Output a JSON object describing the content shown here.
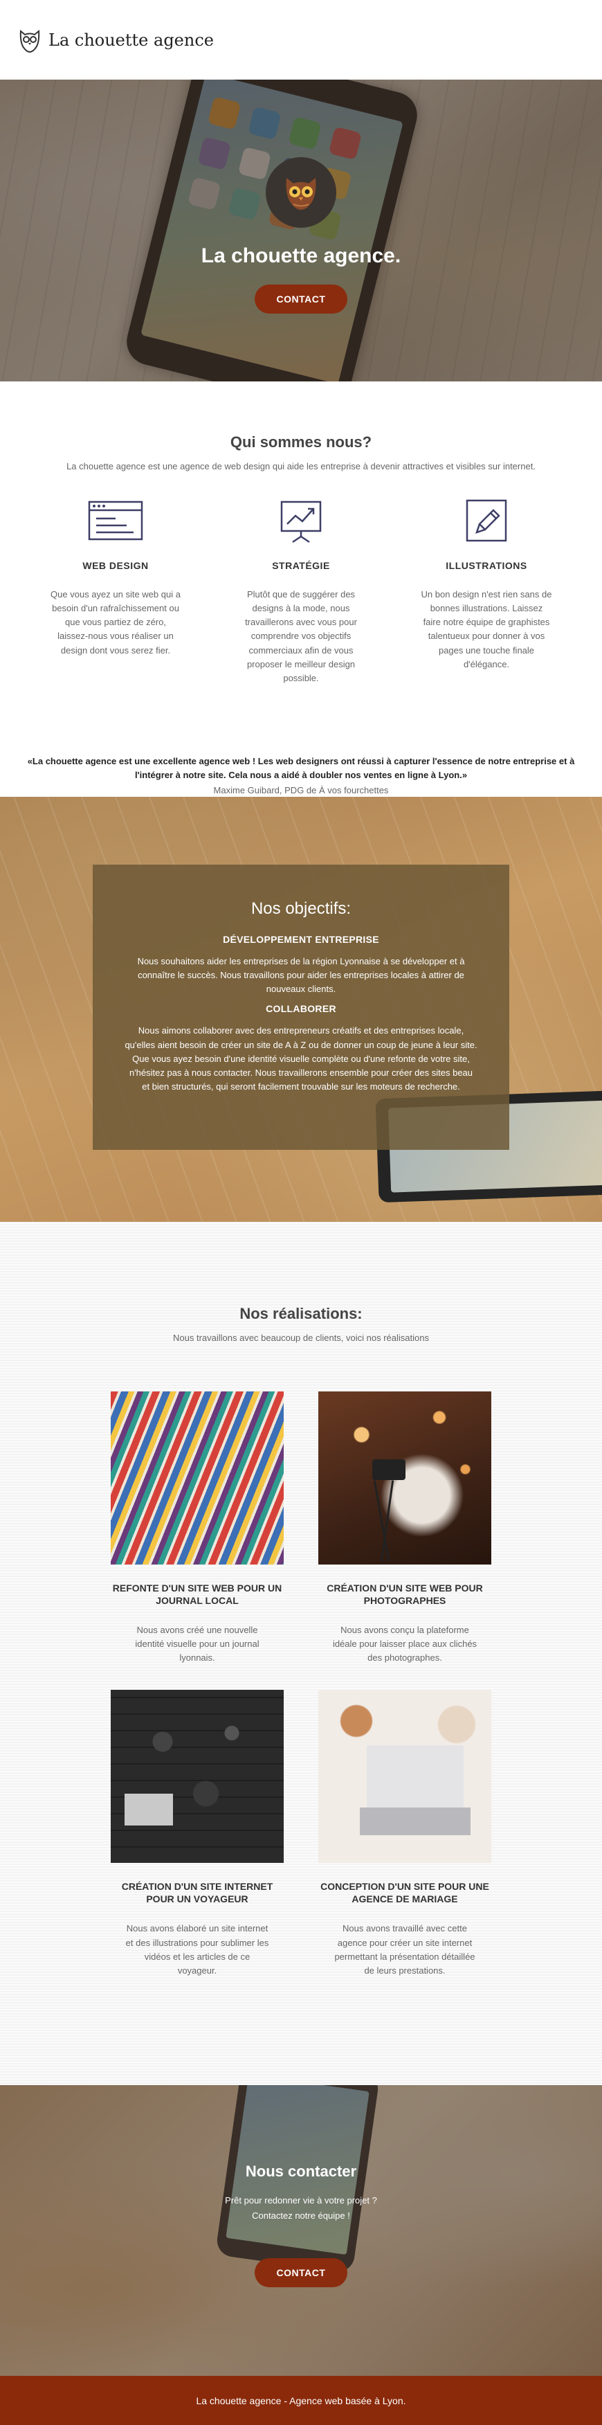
{
  "header": {
    "brand": "La chouette agence"
  },
  "hero": {
    "title": "La chouette agence.",
    "button": "CONTACT"
  },
  "about": {
    "title": "Qui sommes nous?",
    "lead": "La chouette agence est une agence de web design qui aide les entreprise à devenir attractives et visibles sur internet.",
    "services": [
      {
        "icon": "browser-window-icon",
        "title": "WEB DESIGN",
        "text": "Que vous ayez un site web qui a besoin d'un rafraîchissement ou que vous partiez de zéro, laissez-nous vous réaliser un design dont vous serez fier."
      },
      {
        "icon": "chart-board-icon",
        "title": "STRATÉGIE",
        "text": "Plutôt que de suggérer des designs à la mode, nous travaillerons avec vous pour comprendre vos objectifs commerciaux afin de vous proposer le meilleur design possible."
      },
      {
        "icon": "pencil-icon",
        "title": "ILLUSTRATIONS",
        "text": "Un bon design n'est rien sans de bonnes illustrations. Laissez faire notre équipe de graphistes talentueux pour donner à vos pages une touche finale d'élégance."
      }
    ]
  },
  "testimonial": {
    "quote": "«La chouette agence est une excellente agence web ! Les web designers ont réussi à capturer l'essence de notre entreprise et à l'intégrer à notre site. Cela nous a aidé à doubler nos ventes en ligne à Lyon.»",
    "author": "Maxime Guibard, PDG de À vos fourchettes"
  },
  "goals": {
    "title": "Nos objectifs:",
    "sections": [
      {
        "subtitle": "DÉVELOPPEMENT ENTREPRISE",
        "text": "Nous souhaitons aider les entreprises de la région Lyonnaise à se développer et à connaître le succès. Nous travaillons pour aider les entreprises locales à attirer de nouveaux clients."
      },
      {
        "subtitle": "COLLABORER",
        "text": "Nous aimons collaborer avec des entrepreneurs créatifs et des entreprises locale, qu'elles aient besoin de créer un site de A à Z ou de donner un coup de jeune à leur site. Que vous ayez besoin d'une identité visuelle complète ou d'une refonte de votre site, n'hésitez pas à nous contacter. Nous travaillerons ensemble pour créer des sites beau et bien structurés, qui seront facilement trouvable sur les moteurs de recherche."
      }
    ]
  },
  "works": {
    "title": "Nos réalisations:",
    "lead": "Nous travaillons avec beaucoup de clients, voici nos réalisations",
    "items": [
      {
        "title": "REFONTE D'UN SITE WEB POUR UN JOURNAL LOCAL",
        "text": "Nous avons créé une nouvelle identité visuelle pour un journal lyonnais."
      },
      {
        "title": "CRÉATION D'UN SITE WEB POUR PHOTOGRAPHES",
        "text": "Nous avons conçu la plateforme idéale pour laisser place aux clichés des photographes."
      },
      {
        "title": "CRÉATION D'UN SITE INTERNET POUR UN VOYAGEUR",
        "text": "Nous avons élaboré un site internet et des illustrations pour sublimer les vidéos et les articles de ce voyageur."
      },
      {
        "title": "CONCEPTION D'UN SITE POUR UNE AGENCE DE MARIAGE",
        "text": "Nous avons travaillé avec cette agence pour créer un site internet permettant la présentation détaillée de leurs prestations."
      }
    ]
  },
  "contact": {
    "title": "Nous contacter",
    "line1": "Prêt pour redonner vie à votre projet ?",
    "line2": "Contactez notre équipe !",
    "button": "CONTACT"
  },
  "footer": {
    "text": "La chouette agence - Agence web basée à Lyon."
  },
  "colors": {
    "accent": "#8b2c0e",
    "footer": "#8a2a0b",
    "icon": "#3d3f66"
  }
}
